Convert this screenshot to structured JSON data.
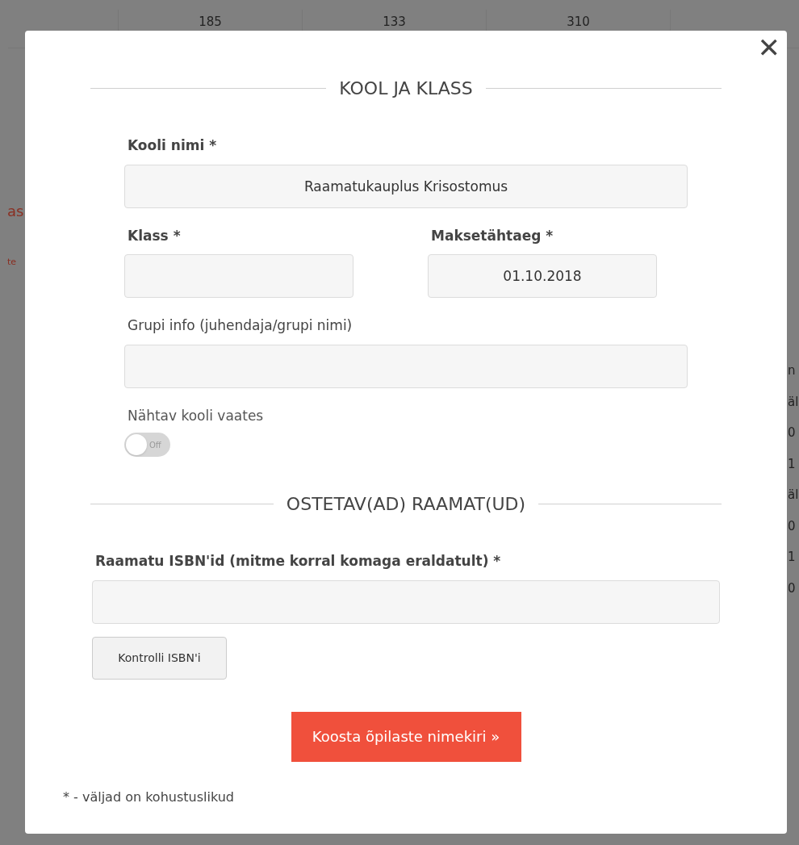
{
  "background": {
    "header_cells": [
      "185",
      "133",
      "310"
    ],
    "left_fragments": [
      "as",
      "te"
    ],
    "right_fragments": [
      "n",
      "äl",
      "0",
      "1",
      "äl",
      "0",
      "1",
      "0"
    ]
  },
  "modal": {
    "close": "✕",
    "section_1": {
      "title": "KOOL JA KLASS"
    },
    "fields": [
      {
        "kind": "wide",
        "label": "Kooli nimi *",
        "bold": true,
        "value": "Raamatukauplus Krisostomus"
      },
      {
        "kind": "narrow",
        "label": "Klass *",
        "bold": true
      },
      {
        "kind": "narrow",
        "label": "Maksetähtaeg *",
        "bold": true,
        "value": "01.10.2018"
      },
      {
        "kind": "wide",
        "label": "Grupi info (juhendaja/grupi nimi)",
        "bold": false
      },
      {
        "kind": "toggle",
        "label": "Nähtav kooli vaates",
        "on": false,
        "state_label": "Off"
      }
    ],
    "section_2": {
      "title": "OSTETAV(AD) RAAMAT(UD)"
    },
    "isbn": {
      "label": "Raamatu ISBN'id (mitme korral komaga eraldatult) *"
    },
    "check_button": "Kontrolli ISBN'i",
    "submit_button": "Koosta õpilaste nimekiri »",
    "footnote": "* - väljad on kohustuslikud"
  }
}
